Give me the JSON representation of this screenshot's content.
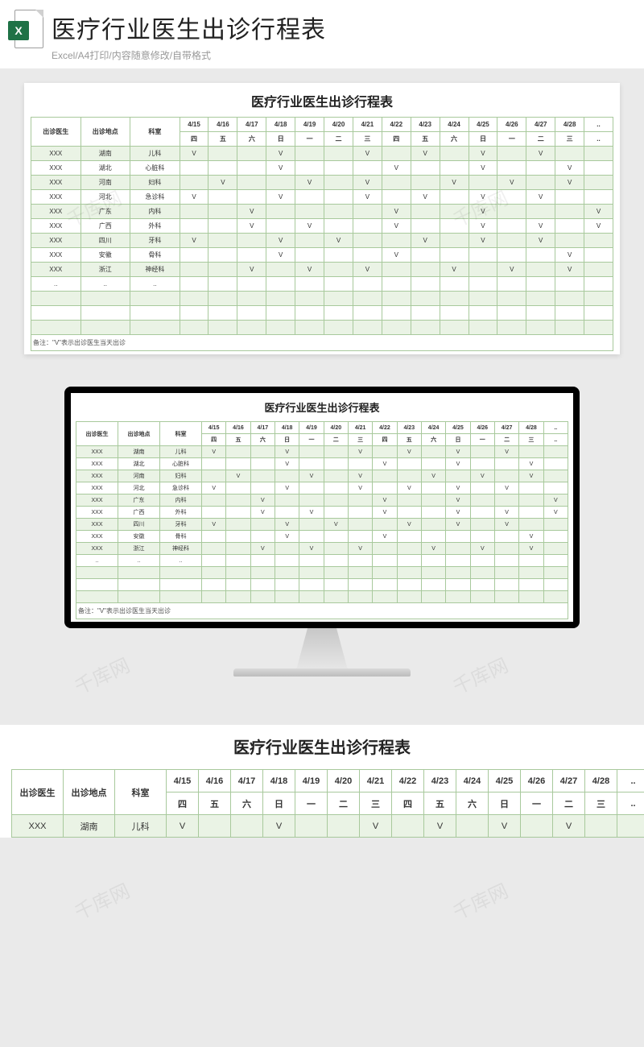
{
  "header": {
    "title": "医疗行业医生出诊行程表",
    "sub": "Excel/A4打印/内容随意修改/自带格式",
    "icon_letter": "X"
  },
  "sheet": {
    "title": "医疗行业医生出诊行程表",
    "left_headers": [
      "出诊医生",
      "出诊地点",
      "科室"
    ],
    "dates": [
      "4/15",
      "4/16",
      "4/17",
      "4/18",
      "4/19",
      "4/20",
      "4/21",
      "4/22",
      "4/23",
      "4/24",
      "4/25",
      "4/26",
      "4/27",
      "4/28",
      ".."
    ],
    "weekdays": [
      "四",
      "五",
      "六",
      "日",
      "一",
      "二",
      "三",
      "四",
      "五",
      "六",
      "日",
      "一",
      "二",
      "三",
      ".."
    ],
    "rows": [
      {
        "doctor": "XXX",
        "loc": "湖南",
        "dept": "儿科",
        "v": [
          "V",
          "",
          "",
          "V",
          "",
          "",
          "V",
          "",
          "V",
          "",
          "V",
          "",
          "V",
          "",
          ""
        ]
      },
      {
        "doctor": "XXX",
        "loc": "湖北",
        "dept": "心脏科",
        "v": [
          "",
          "",
          "",
          "V",
          "",
          "",
          "",
          "V",
          "",
          "",
          "V",
          "",
          "",
          "V",
          ""
        ]
      },
      {
        "doctor": "XXX",
        "loc": "河南",
        "dept": "妇科",
        "v": [
          "",
          "V",
          "",
          "",
          "V",
          "",
          "V",
          "",
          "",
          "V",
          "",
          "V",
          "",
          "V",
          ""
        ]
      },
      {
        "doctor": "XXX",
        "loc": "河北",
        "dept": "急诊科",
        "v": [
          "V",
          "",
          "",
          "V",
          "",
          "",
          "V",
          "",
          "V",
          "",
          "V",
          "",
          "V",
          "",
          ""
        ]
      },
      {
        "doctor": "XXX",
        "loc": "广东",
        "dept": "内科",
        "v": [
          "",
          "",
          "V",
          "",
          "",
          "",
          "",
          "V",
          "",
          "",
          "V",
          "",
          "",
          "",
          "V",
          ""
        ]
      },
      {
        "doctor": "XXX",
        "loc": "广西",
        "dept": "外科",
        "v": [
          "",
          "",
          "V",
          "",
          "V",
          "",
          "",
          "V",
          "",
          "",
          "V",
          "",
          "V",
          "",
          "V",
          ""
        ]
      },
      {
        "doctor": "XXX",
        "loc": "四川",
        "dept": "牙科",
        "v": [
          "V",
          "",
          "",
          "V",
          "",
          "V",
          "",
          "",
          "V",
          "",
          "V",
          "",
          "V",
          "",
          ""
        ]
      },
      {
        "doctor": "XXX",
        "loc": "安徽",
        "dept": "骨科",
        "v": [
          "",
          "",
          "",
          "V",
          "",
          "",
          "",
          "V",
          "",
          "",
          "",
          "",
          "",
          "V",
          ""
        ]
      },
      {
        "doctor": "XXX",
        "loc": "浙江",
        "dept": "神经科",
        "v": [
          "",
          "",
          "V",
          "",
          "V",
          "",
          "V",
          "",
          "",
          "V",
          "",
          "V",
          "",
          "V",
          ""
        ]
      },
      {
        "doctor": "..",
        "loc": "..",
        "dept": "..",
        "v": [
          "",
          "",
          "",
          "",
          "",
          "",
          "",
          "",
          "",
          "",
          "",
          "",
          "",
          "",
          ""
        ]
      },
      {
        "doctor": "",
        "loc": "",
        "dept": "",
        "v": [
          "",
          "",
          "",
          "",
          "",
          "",
          "",
          "",
          "",
          "",
          "",
          "",
          "",
          "",
          ""
        ]
      },
      {
        "doctor": "",
        "loc": "",
        "dept": "",
        "v": [
          "",
          "",
          "",
          "",
          "",
          "",
          "",
          "",
          "",
          "",
          "",
          "",
          "",
          "",
          ""
        ]
      },
      {
        "doctor": "",
        "loc": "",
        "dept": "",
        "v": [
          "",
          "",
          "",
          "",
          "",
          "",
          "",
          "",
          "",
          "",
          "",
          "",
          "",
          "",
          ""
        ]
      }
    ],
    "footnote": "备注：\"V\"表示出诊医生当天出诊"
  },
  "watermark": "千库网"
}
